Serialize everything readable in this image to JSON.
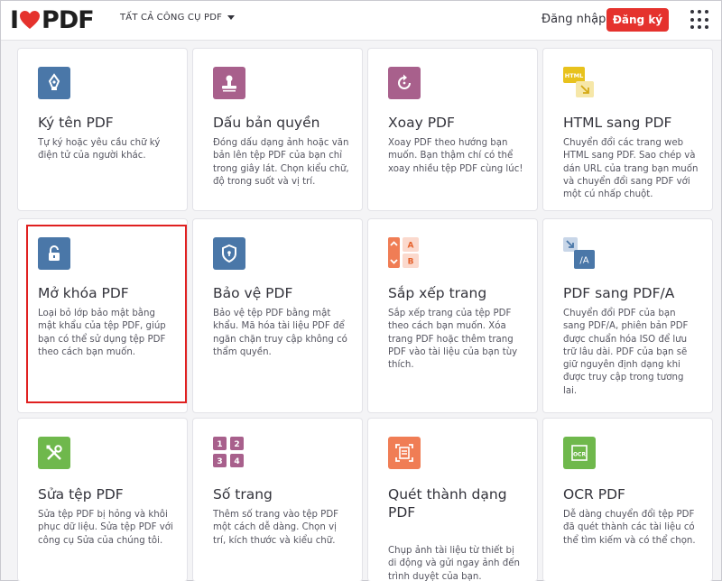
{
  "header": {
    "logo_left": "I",
    "logo_right": "PDF",
    "tools_menu": "TẤT CẢ CÔNG CỤ PDF",
    "login": "Đăng nhập",
    "signup": "Đăng ký"
  },
  "colors": {
    "brand_red": "#e5322d",
    "blue": "#4a77a8",
    "purple": "#a8608c",
    "green": "#6fb84c",
    "orange": "#f07d55",
    "yellow": "#e8c21d",
    "highlight": "#e02020"
  },
  "tools": [
    {
      "title": "Ký tên PDF",
      "desc": "Tự ký hoặc yêu cầu chữ ký điện tử của người khác.",
      "icon": "pen-sign-icon"
    },
    {
      "title": "Dấu bản quyền",
      "desc": "Đóng dấu dạng ảnh hoặc văn bản lên tệp PDF của bạn chỉ trong giây lát. Chọn kiểu chữ, độ trong suốt và vị trí.",
      "icon": "stamp-icon"
    },
    {
      "title": "Xoay PDF",
      "desc": "Xoay PDF theo hướng bạn muốn. Bạn thậm chí có thể xoay nhiều tệp PDF cùng lúc!",
      "icon": "rotate-icon"
    },
    {
      "title": "HTML sang PDF",
      "desc": "Chuyển đổi các trang web HTML sang PDF. Sao chép và dán URL của trang bạn muốn và chuyển đổi sang PDF với một cú nhấp chuột.",
      "icon": "html-to-pdf-icon",
      "icon_label": "HTML"
    },
    {
      "title": "Mở khóa PDF",
      "desc": "Loại bỏ lớp bảo mật bằng mật khẩu của tệp PDF, giúp bạn có thể sử dụng tệp PDF theo cách bạn muốn.",
      "icon": "unlock-icon"
    },
    {
      "title": "Bảo vệ PDF",
      "desc": "Bảo vệ tệp PDF bằng mật khẩu. Mã hóa tài liệu PDF để ngăn chặn truy cập không có thẩm quyền.",
      "icon": "shield-icon"
    },
    {
      "title": "Sắp xếp trang",
      "desc": "Sắp xếp trang của tệp PDF theo cách bạn muốn. Xóa trang PDF hoặc thêm trang PDF vào tài liệu của bạn tùy thích.",
      "icon": "organize-pages-icon",
      "icon_label_a": "A",
      "icon_label_b": "B"
    },
    {
      "title": "PDF sang PDF/A",
      "desc": "Chuyển đổi PDF của bạn sang PDF/A, phiên bản PDF được chuẩn hóa ISO để lưu trữ lâu dài. PDF của bạn sẽ giữ nguyên định dạng khi được truy cập trong tương lai.",
      "icon": "pdf-to-pdfa-icon",
      "icon_label": "/A"
    },
    {
      "title": "Sửa tệp PDF",
      "desc": "Sửa tệp PDF bị hỏng và khôi phục dữ liệu. Sửa tệp PDF với công cụ Sửa của chúng tôi.",
      "icon": "repair-tools-icon"
    },
    {
      "title": "Số trang",
      "desc": "Thêm số trang vào tệp PDF một cách dễ dàng. Chọn vị trí, kích thước và kiểu chữ.",
      "icon": "page-numbers-icon",
      "icon_digits": [
        "1",
        "2",
        "3",
        "4"
      ]
    },
    {
      "title": "Quét thành dạng PDF",
      "desc": "Chụp ảnh tài liệu từ thiết bị di động và gửi ngay ảnh đến trình duyệt của bạn.",
      "icon": "scan-icon"
    },
    {
      "title": "OCR PDF",
      "desc": "Dễ dàng chuyển đổi tệp PDF đã quét thành các tài liệu có thể tìm kiếm và có thể chọn.",
      "icon": "ocr-icon",
      "icon_label": "OCR"
    }
  ]
}
